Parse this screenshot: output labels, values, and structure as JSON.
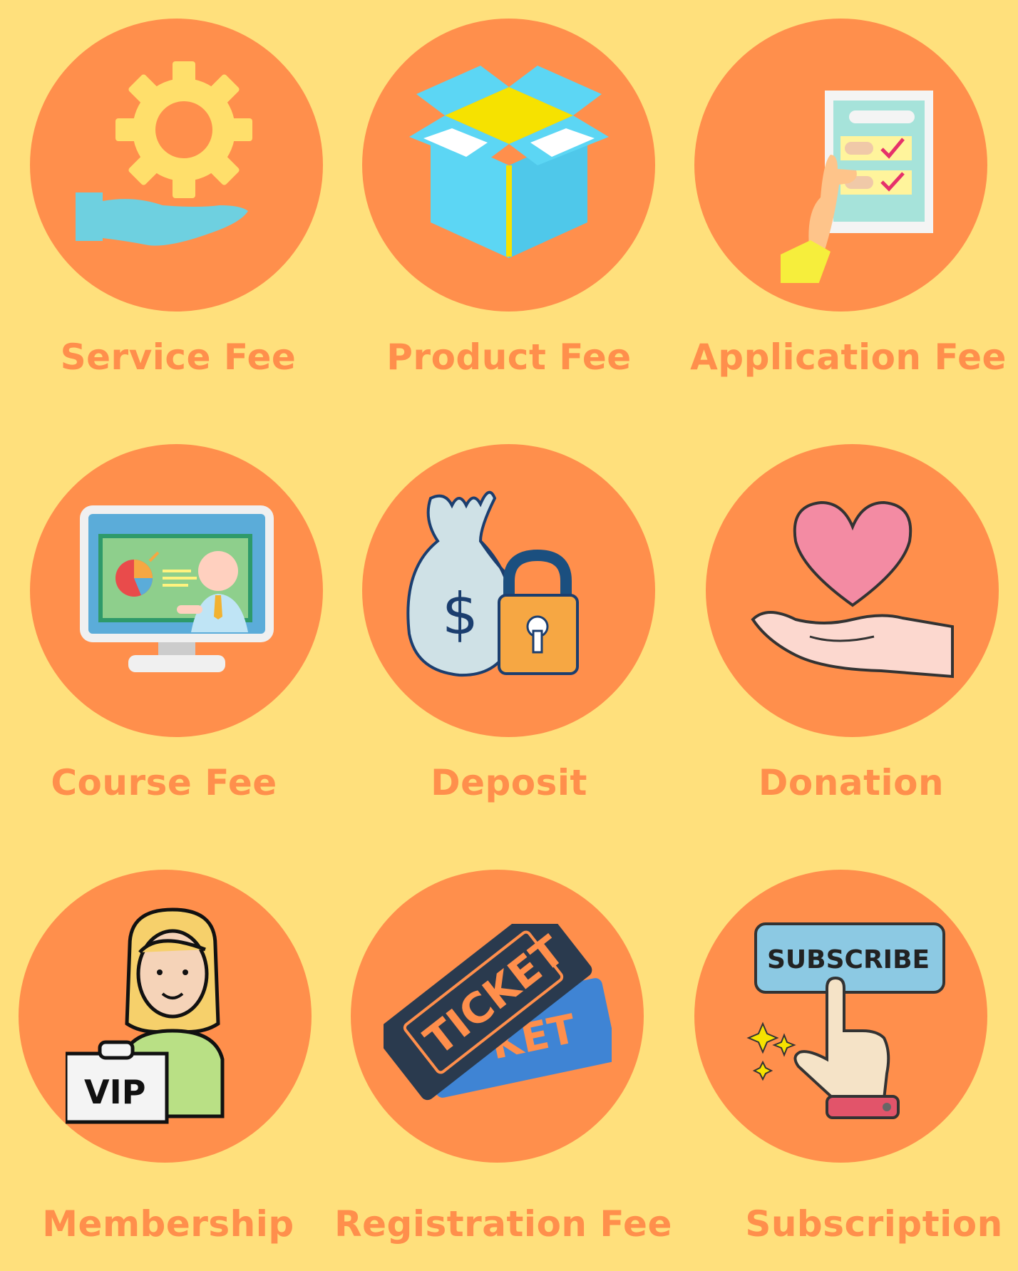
{
  "items": [
    {
      "label": "Service Fee",
      "icon": "hand-gear-icon"
    },
    {
      "label": "Product Fee",
      "icon": "open-box-icon"
    },
    {
      "label": "Application Fee",
      "icon": "hand-checklist-icon"
    },
    {
      "label": "Course Fee",
      "icon": "online-course-monitor-icon"
    },
    {
      "label": "Deposit",
      "icon": "money-bag-padlock-icon"
    },
    {
      "label": "Donation",
      "icon": "hand-heart-icon"
    },
    {
      "label": "Membership",
      "icon": "vip-member-icon"
    },
    {
      "label": "Registration Fee",
      "icon": "tickets-icon"
    },
    {
      "label": "Subscription",
      "icon": "subscribe-button-icon"
    }
  ],
  "ticket_front_text": "TICKET",
  "ticket_back_text": "KET",
  "vip_text": "VIP",
  "subscribe_text": "SUBSCRIBE",
  "colors": {
    "background": "#FFE07C",
    "circle": "#FF8F4C",
    "label": "#FF8F4C"
  }
}
